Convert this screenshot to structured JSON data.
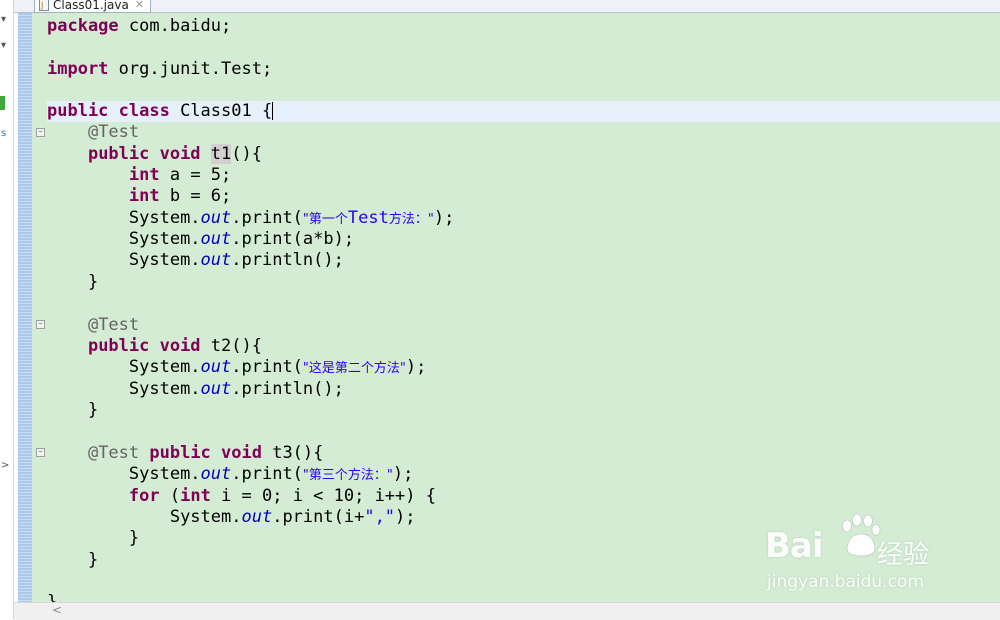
{
  "editor": {
    "tab_label": "Class01.java",
    "tab_close_glyph": "✕",
    "colors": {
      "background": "#d4ecd4",
      "keyword": "#7f0055",
      "annotation": "#646464",
      "static_field": "#0000c0",
      "string": "#2a00ff",
      "current_line": "#e6f0fb"
    },
    "code": {
      "l1_kw": "package",
      "l1_rest": " com.baidu;",
      "l3_kw": "import",
      "l3_rest": " org.junit.Test;",
      "l5_kw": "public class",
      "l5_rest": " Class01 {",
      "ann_test": "@Test",
      "kw_public_void": "public void",
      "t1_name": "t1",
      "t1_rest": "(){",
      "kw_int": "int",
      "l8_rest": " a = 5;",
      "l9_rest": " b = 6;",
      "system": "System.",
      "out": "out",
      "print_open": ".print(",
      "println_call": ".println();",
      "str_t1_cjk1": "\"第一个",
      "str_t1_test": "Test",
      "str_t1_cjk2": "方法：\"",
      "close_paren_semi": ");",
      "l11_args": ".print(a*b);",
      "close_brace": "}",
      "t2_sig": " t2(){",
      "str_t2": "\"这是第二个方法\"",
      "ann_test_space": "@Test ",
      "t3_sig": " t3(){",
      "str_t3": "\"第三个方法：\"",
      "kw_for": "for",
      "for_open": " (",
      "for_rest": " i = 0; i < 10; i++) {",
      "print_i_open": ".print(i+",
      "str_comma": "\",\"",
      "last_brace": "}"
    }
  },
  "watermark": {
    "logo_text": "Bai",
    "logo_suffix": "经验",
    "url": "jingyan.baidu.com"
  },
  "left_strip": {
    "s_char": "s",
    "chevron": ">",
    "dropdown": "▾"
  },
  "scrollbar": {
    "left_arrow": "<"
  }
}
